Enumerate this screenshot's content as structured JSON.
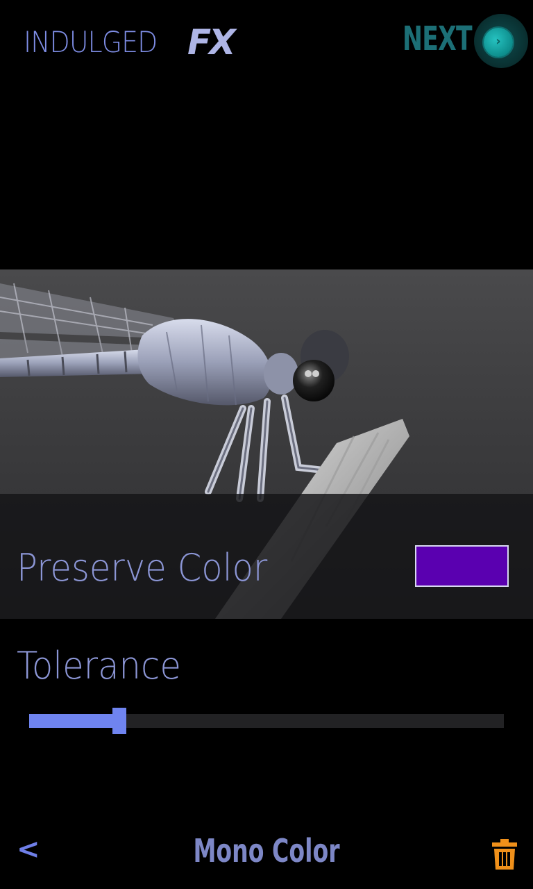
{
  "header": {
    "app_name": "INDULGED",
    "app_suffix": "FX",
    "next_label": "NEXT",
    "next_icon": "chevron-right-icon"
  },
  "photo": {
    "subject": "damselfly-photo"
  },
  "preserve": {
    "label": "Preserve Color",
    "swatch_color": "#5a00b0"
  },
  "tolerance": {
    "label": "Tolerance",
    "value_fraction": 0.19
  },
  "footer": {
    "back_label": "<",
    "title": "Mono Color",
    "delete_icon": "trash-icon"
  },
  "colors": {
    "accent": "#6f84f0",
    "teal": "#1c6f76",
    "trash": "#f0901a"
  }
}
